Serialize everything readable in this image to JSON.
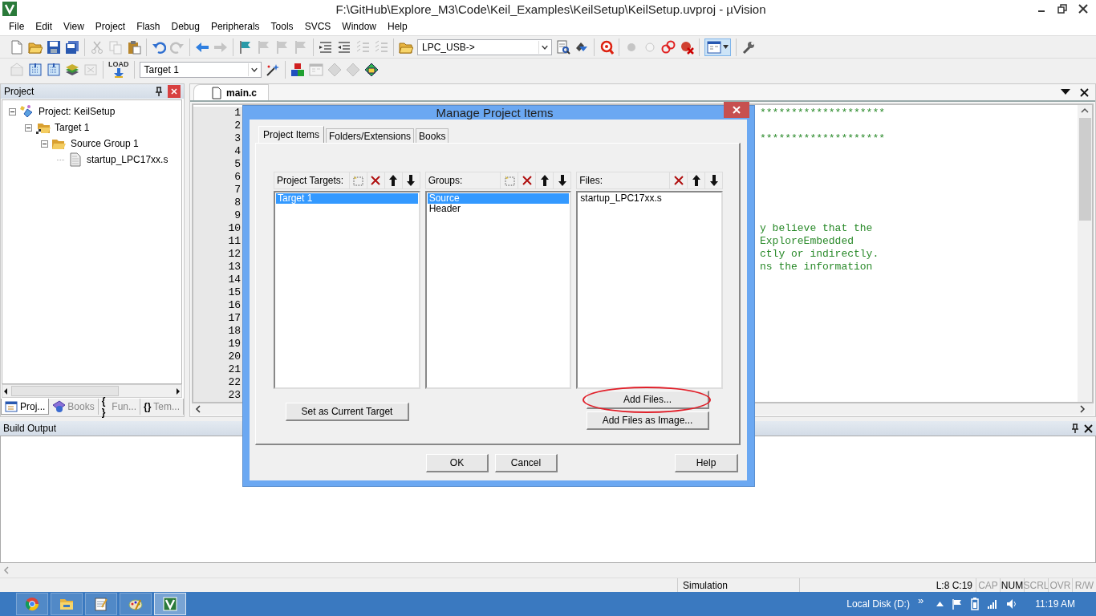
{
  "window": {
    "title": "F:\\GitHub\\Explore_M3\\Code\\Keil_Examples\\KeilSetup\\KeilSetup.uvproj - µVision"
  },
  "menu": [
    "File",
    "Edit",
    "View",
    "Project",
    "Flash",
    "Debug",
    "Peripherals",
    "Tools",
    "SVCS",
    "Window",
    "Help"
  ],
  "toolbar_1": [
    {
      "items": [
        {
          "kind": "new",
          "disabled": false
        },
        {
          "kind": "open",
          "disabled": false
        },
        {
          "kind": "save",
          "disabled": false
        },
        {
          "kind": "saveall",
          "disabled": false
        }
      ]
    },
    {
      "items": [
        {
          "kind": "cut",
          "disabled": true
        },
        {
          "kind": "copy",
          "disabled": true
        },
        {
          "kind": "paste",
          "disabled": false
        }
      ]
    },
    {
      "items": [
        {
          "kind": "undo",
          "disabled": false
        },
        {
          "kind": "redo",
          "disabled": true
        }
      ]
    },
    {
      "items": [
        {
          "kind": "back",
          "disabled": false
        },
        {
          "kind": "forward",
          "disabled": true
        }
      ]
    },
    {
      "items": [
        {
          "kind": "flag",
          "disabled": false
        },
        {
          "kind": "flag",
          "disabled": true
        },
        {
          "kind": "flag",
          "disabled": true
        },
        {
          "kind": "flag",
          "disabled": true
        }
      ]
    },
    {
      "items": [
        {
          "kind": "indent",
          "disabled": false
        },
        {
          "kind": "outdent",
          "disabled": false
        },
        {
          "kind": "comment",
          "disabled": true
        },
        {
          "kind": "comment",
          "disabled": true
        }
      ]
    },
    {
      "items": [
        {
          "kind": "open",
          "disabled": false
        },
        {
          "kind": "combo",
          "value": "LPC_USB->",
          "disabled": false
        },
        {
          "kind": "find",
          "disabled": false
        },
        {
          "kind": "tool",
          "disabled": false
        }
      ]
    },
    {
      "items": [
        {
          "kind": "debug",
          "disabled": false
        }
      ]
    },
    {
      "items": [
        {
          "kind": "dot",
          "disabled": true
        },
        {
          "kind": "ring",
          "disabled": true
        },
        {
          "kind": "rings",
          "disabled": false
        },
        {
          "kind": "kill",
          "disabled": false
        }
      ]
    },
    {
      "items": [
        {
          "kind": "windows",
          "disabled": false,
          "pressed": true
        }
      ]
    },
    {
      "items": [
        {
          "kind": "wrench",
          "disabled": false
        }
      ]
    }
  ],
  "toolbar_2": [
    {
      "items": [
        {
          "kind": "translate",
          "disabled": true
        },
        {
          "kind": "build",
          "disabled": false
        },
        {
          "kind": "build",
          "disabled": false
        },
        {
          "kind": "stack",
          "disabled": false
        },
        {
          "kind": "stop",
          "disabled": true
        }
      ]
    },
    {
      "items": [
        {
          "kind": "load",
          "label": "LOAD",
          "disabled": false
        }
      ]
    },
    {
      "items": [
        {
          "kind": "combo",
          "value": "Target 1",
          "disabled": false
        },
        {
          "kind": "wand",
          "disabled": false
        }
      ]
    },
    {
      "items": [
        {
          "kind": "blocks",
          "disabled": false
        },
        {
          "kind": "windows",
          "disabled": true
        },
        {
          "kind": "diamond",
          "disabled": true
        },
        {
          "kind": "diamond",
          "disabled": true
        },
        {
          "kind": "pack",
          "disabled": false
        }
      ]
    }
  ],
  "project_panel": {
    "title": "Project",
    "tree": [
      {
        "label": "Project: KeilSetup",
        "kind": "project",
        "expanded": true,
        "children": [
          {
            "label": "Target 1",
            "kind": "target",
            "expanded": true,
            "children": [
              {
                "label": "Source Group 1",
                "kind": "group",
                "expanded": true,
                "children": [
                  {
                    "label": "startup_LPC17xx.s",
                    "kind": "file"
                  }
                ]
              }
            ]
          }
        ]
      }
    ],
    "tabs": [
      {
        "label": "Proj...",
        "kind": "project",
        "selected": true
      },
      {
        "label": "Books",
        "kind": "books",
        "selected": false
      },
      {
        "label": "Fun...",
        "kind": "functions",
        "glyph": "{ }",
        "selected": false
      },
      {
        "label": "Tem...",
        "kind": "templates",
        "glyph": "{}",
        "selected": false
      }
    ]
  },
  "editor": {
    "tabs": [
      {
        "label": "main.c",
        "selected": true
      }
    ],
    "lines": [
      {
        "number": "1",
        "text": "********************"
      },
      {
        "number": "2"
      },
      {
        "number": "3",
        "text": "********************"
      },
      {
        "number": "4"
      },
      {
        "number": "5"
      },
      {
        "number": "6"
      },
      {
        "number": "7"
      },
      {
        "number": "8"
      },
      {
        "number": "9"
      },
      {
        "number": "10",
        "text": "y believe that the"
      },
      {
        "number": "11",
        "text": "ExploreEmbedded"
      },
      {
        "number": "12",
        "text": "ctly or indirectly."
      },
      {
        "number": "13",
        "text": "ns the information"
      },
      {
        "number": "14"
      },
      {
        "number": "15"
      },
      {
        "number": "16"
      },
      {
        "number": "17"
      },
      {
        "number": "18"
      },
      {
        "number": "19"
      },
      {
        "number": "20"
      },
      {
        "number": "21"
      },
      {
        "number": "22"
      },
      {
        "number": "23"
      }
    ]
  },
  "build_output": {
    "title": "Build Output"
  },
  "status_bar": {
    "mode": "Simulation",
    "position": "L:8 C:19",
    "indicators": [
      {
        "label": "CAP",
        "on": false
      },
      {
        "label": "NUM",
        "on": true
      },
      {
        "label": "SCRL",
        "on": false
      },
      {
        "label": "OVR",
        "on": false
      },
      {
        "label": "R/W",
        "on": false
      }
    ]
  },
  "taskbar": {
    "apps": [
      {
        "kind": "browser",
        "selected": false
      },
      {
        "kind": "explorer",
        "selected": false
      },
      {
        "kind": "notepad",
        "selected": false
      },
      {
        "kind": "paint",
        "selected": false
      },
      {
        "kind": "uvision",
        "selected": true
      }
    ],
    "toolbar_label": "Local Disk (D:)",
    "chevron": "»",
    "time": "11:19 AM"
  },
  "dialog": {
    "title": "Manage Project Items",
    "tabs": [
      {
        "label": "Project Items",
        "selected": true
      },
      {
        "label": "Folders/Extensions",
        "selected": false
      },
      {
        "label": "Books",
        "selected": false
      }
    ],
    "lists": [
      {
        "title": "Project Targets:",
        "kind": "targets",
        "items": [
          {
            "label": "Target 1",
            "selected": true
          }
        ]
      },
      {
        "title": "Groups:",
        "kind": "groups",
        "items": [
          {
            "label": "Source",
            "selected": true
          },
          {
            "label": "Header",
            "selected": false
          }
        ]
      },
      {
        "title": "Files:",
        "kind": "files",
        "items": [
          {
            "label": "startup_LPC17xx.s",
            "selected": false
          }
        ]
      }
    ],
    "set_current": "Set as Current Target",
    "add_files": {
      "label": "Add Files...",
      "highlighted": true
    },
    "add_image": "Add Files as Image...",
    "buttons": [
      {
        "label": "OK",
        "kind": "ok"
      },
      {
        "label": "Cancel",
        "kind": "cancel"
      },
      {
        "label": "Help",
        "kind": "help"
      }
    ]
  }
}
